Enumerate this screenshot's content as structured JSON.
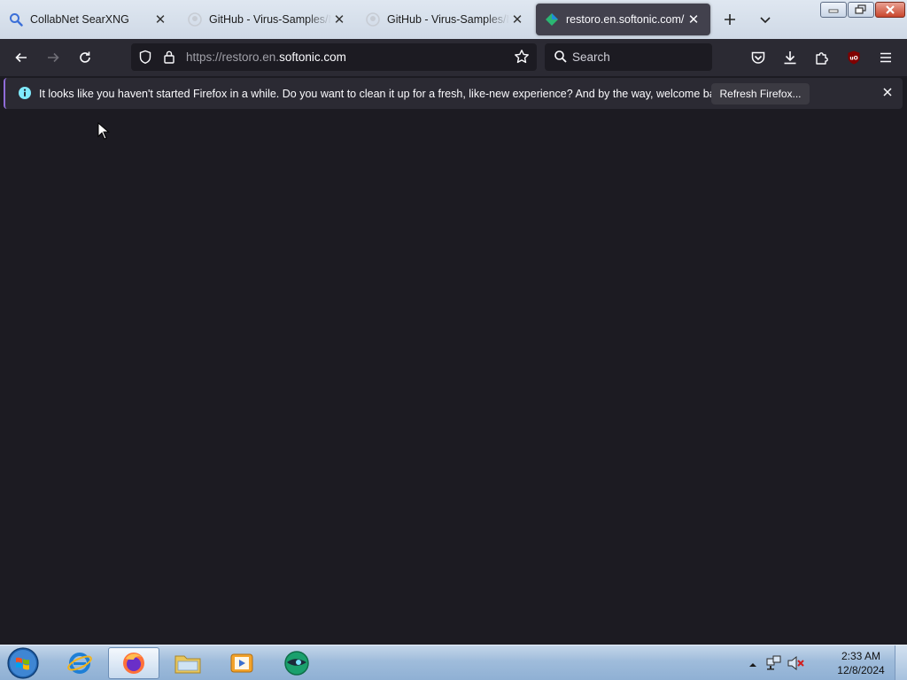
{
  "tabs": [
    {
      "title": "CollabNet SearXNG",
      "icon": "search-icon",
      "active": false
    },
    {
      "title": "GitHub - Virus-Samples/M",
      "icon": "github-icon",
      "active": false
    },
    {
      "title": "GitHub - Virus-Samples/M",
      "icon": "github-icon",
      "active": false
    },
    {
      "title": "restoro.en.softonic.com/",
      "icon": "softonic-icon",
      "active": true
    }
  ],
  "url": {
    "prefix": "https://restoro.en.",
    "host": "softonic.com"
  },
  "search": {
    "placeholder": "Search"
  },
  "notification": {
    "message": "It looks like you haven't started Firefox in a while. Do you want to clean it up for a fresh, like-new experience? And by the way, welcome back!",
    "button": "Refresh Firefox..."
  },
  "clock": {
    "time": "2:33 AM",
    "date": "12/8/2024"
  },
  "colors": {
    "page_bg": "#1c1b22",
    "toolbar": "#2b2a33",
    "active_tab": "#42414d",
    "ublock": "#800000"
  }
}
